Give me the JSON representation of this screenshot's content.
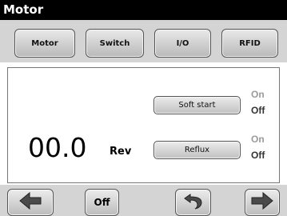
{
  "window": {
    "title": "Motor"
  },
  "tabs": [
    {
      "label": "Motor"
    },
    {
      "label": "Switch"
    },
    {
      "label": "I/O"
    },
    {
      "label": "RFID"
    }
  ],
  "main": {
    "value": "00.0",
    "unit": "Rev",
    "soft_start": {
      "label": "Soft start",
      "on": "On",
      "off": "Off"
    },
    "reflux": {
      "label": "Reflux",
      "on": "On",
      "off": "Off"
    }
  },
  "bottom": {
    "back_icon": "arrow-left-icon",
    "off_label": "Off",
    "undo_icon": "undo-icon",
    "forward_icon": "arrow-right-icon"
  },
  "colors": {
    "titlebar": "#000000",
    "bar_background": "#d4d4d4",
    "on_state": "#9a9a9a",
    "off_state": "#333333"
  }
}
